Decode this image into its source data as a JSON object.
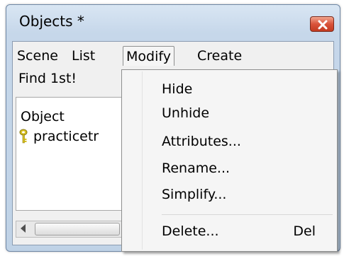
{
  "window": {
    "title": "Objects *"
  },
  "menubar": {
    "items": [
      {
        "label": "Scene"
      },
      {
        "label": "List"
      },
      {
        "label": "Modify"
      },
      {
        "label": "Create"
      }
    ]
  },
  "toolbar": {
    "find_label": "Find 1st!"
  },
  "list": {
    "column_header": "Object",
    "rows": [
      {
        "label": "practicetr",
        "icon": "key-icon"
      }
    ]
  },
  "modify_menu": {
    "items": [
      {
        "label": "Hide"
      },
      {
        "label": "Unhide"
      },
      {
        "label": "Attributes..."
      },
      {
        "label": "Rename..."
      },
      {
        "label": "Simplify..."
      },
      {
        "label": "Delete...",
        "shortcut": "Del"
      }
    ]
  },
  "colors": {
    "close_button": "#c23a20",
    "window_frame": "#c6d7ea",
    "menu_background": "#f5f5f5",
    "key_icon": "#d8c020"
  }
}
